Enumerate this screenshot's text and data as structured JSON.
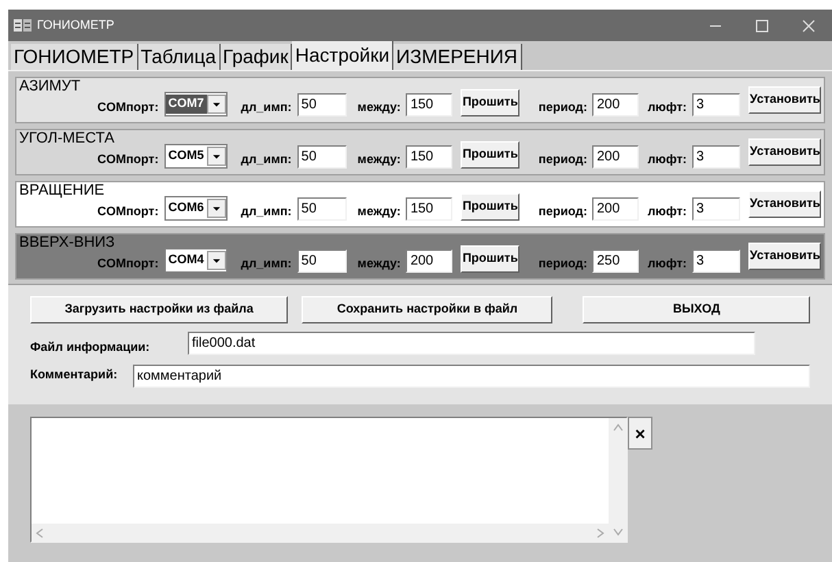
{
  "window": {
    "title": "ГОНИОМЕТР"
  },
  "tabs": [
    {
      "label": "ГОНИОМЕТР",
      "selected": false
    },
    {
      "label": "Таблица",
      "selected": false
    },
    {
      "label": "График",
      "selected": false
    },
    {
      "label": "Настройки",
      "selected": true
    },
    {
      "label": "ИЗМЕРЕНИЯ",
      "selected": false
    }
  ],
  "axes": [
    {
      "title": "АЗИМУТ",
      "color": "#e3e3e3",
      "port_label": "COMпорт:",
      "port": "COM7",
      "port_selected": true,
      "pulse_label": "дл_имп:",
      "pulse": "50",
      "between_label": "между:",
      "between": "150",
      "flash_button": "Прошить",
      "period_label": "период:",
      "period": "200",
      "backlash_label": "люфт:",
      "backlash": "3",
      "set_button": "Установить"
    },
    {
      "title": "УГОЛ-МЕСТА",
      "color": "#d6d6d6",
      "port_label": "COMпорт:",
      "port": "COM5",
      "port_selected": false,
      "pulse_label": "дл_имп:",
      "pulse": "50",
      "between_label": "между:",
      "between": "150",
      "flash_button": "Прошить",
      "period_label": "период:",
      "period": "200",
      "backlash_label": "люфт:",
      "backlash": "3",
      "set_button": "Установить"
    },
    {
      "title": "ВРАЩЕНИЕ",
      "color": "#ffffff",
      "port_label": "COMпорт:",
      "port": "COM6",
      "port_selected": false,
      "pulse_label": "дл_имп:",
      "pulse": "50",
      "between_label": "между:",
      "between": "150",
      "flash_button": "Прошить",
      "period_label": "период:",
      "period": "200",
      "backlash_label": "люфт:",
      "backlash": "3",
      "set_button": "Установить"
    },
    {
      "title": "ВВЕРХ-ВНИЗ",
      "color": "#7d7d7d",
      "port_label": "COMпорт:",
      "port": "COM4",
      "port_selected": false,
      "pulse_label": "дл_имп:",
      "pulse": "50",
      "between_label": "между:",
      "between": "200",
      "flash_button": "Прошить",
      "period_label": "период:",
      "period": "250",
      "backlash_label": "люфт:",
      "backlash": "3",
      "set_button": "Установить"
    }
  ],
  "file_buttons": [
    "Загрузить настройки из файла",
    "Сохранить настройки в файл",
    "ВЫХОД"
  ],
  "info_file": {
    "label": "Файл информации:",
    "value": "file000.dat"
  },
  "comment": {
    "label": "Комментарий:",
    "value": "комментарий"
  },
  "log_close": "×"
}
